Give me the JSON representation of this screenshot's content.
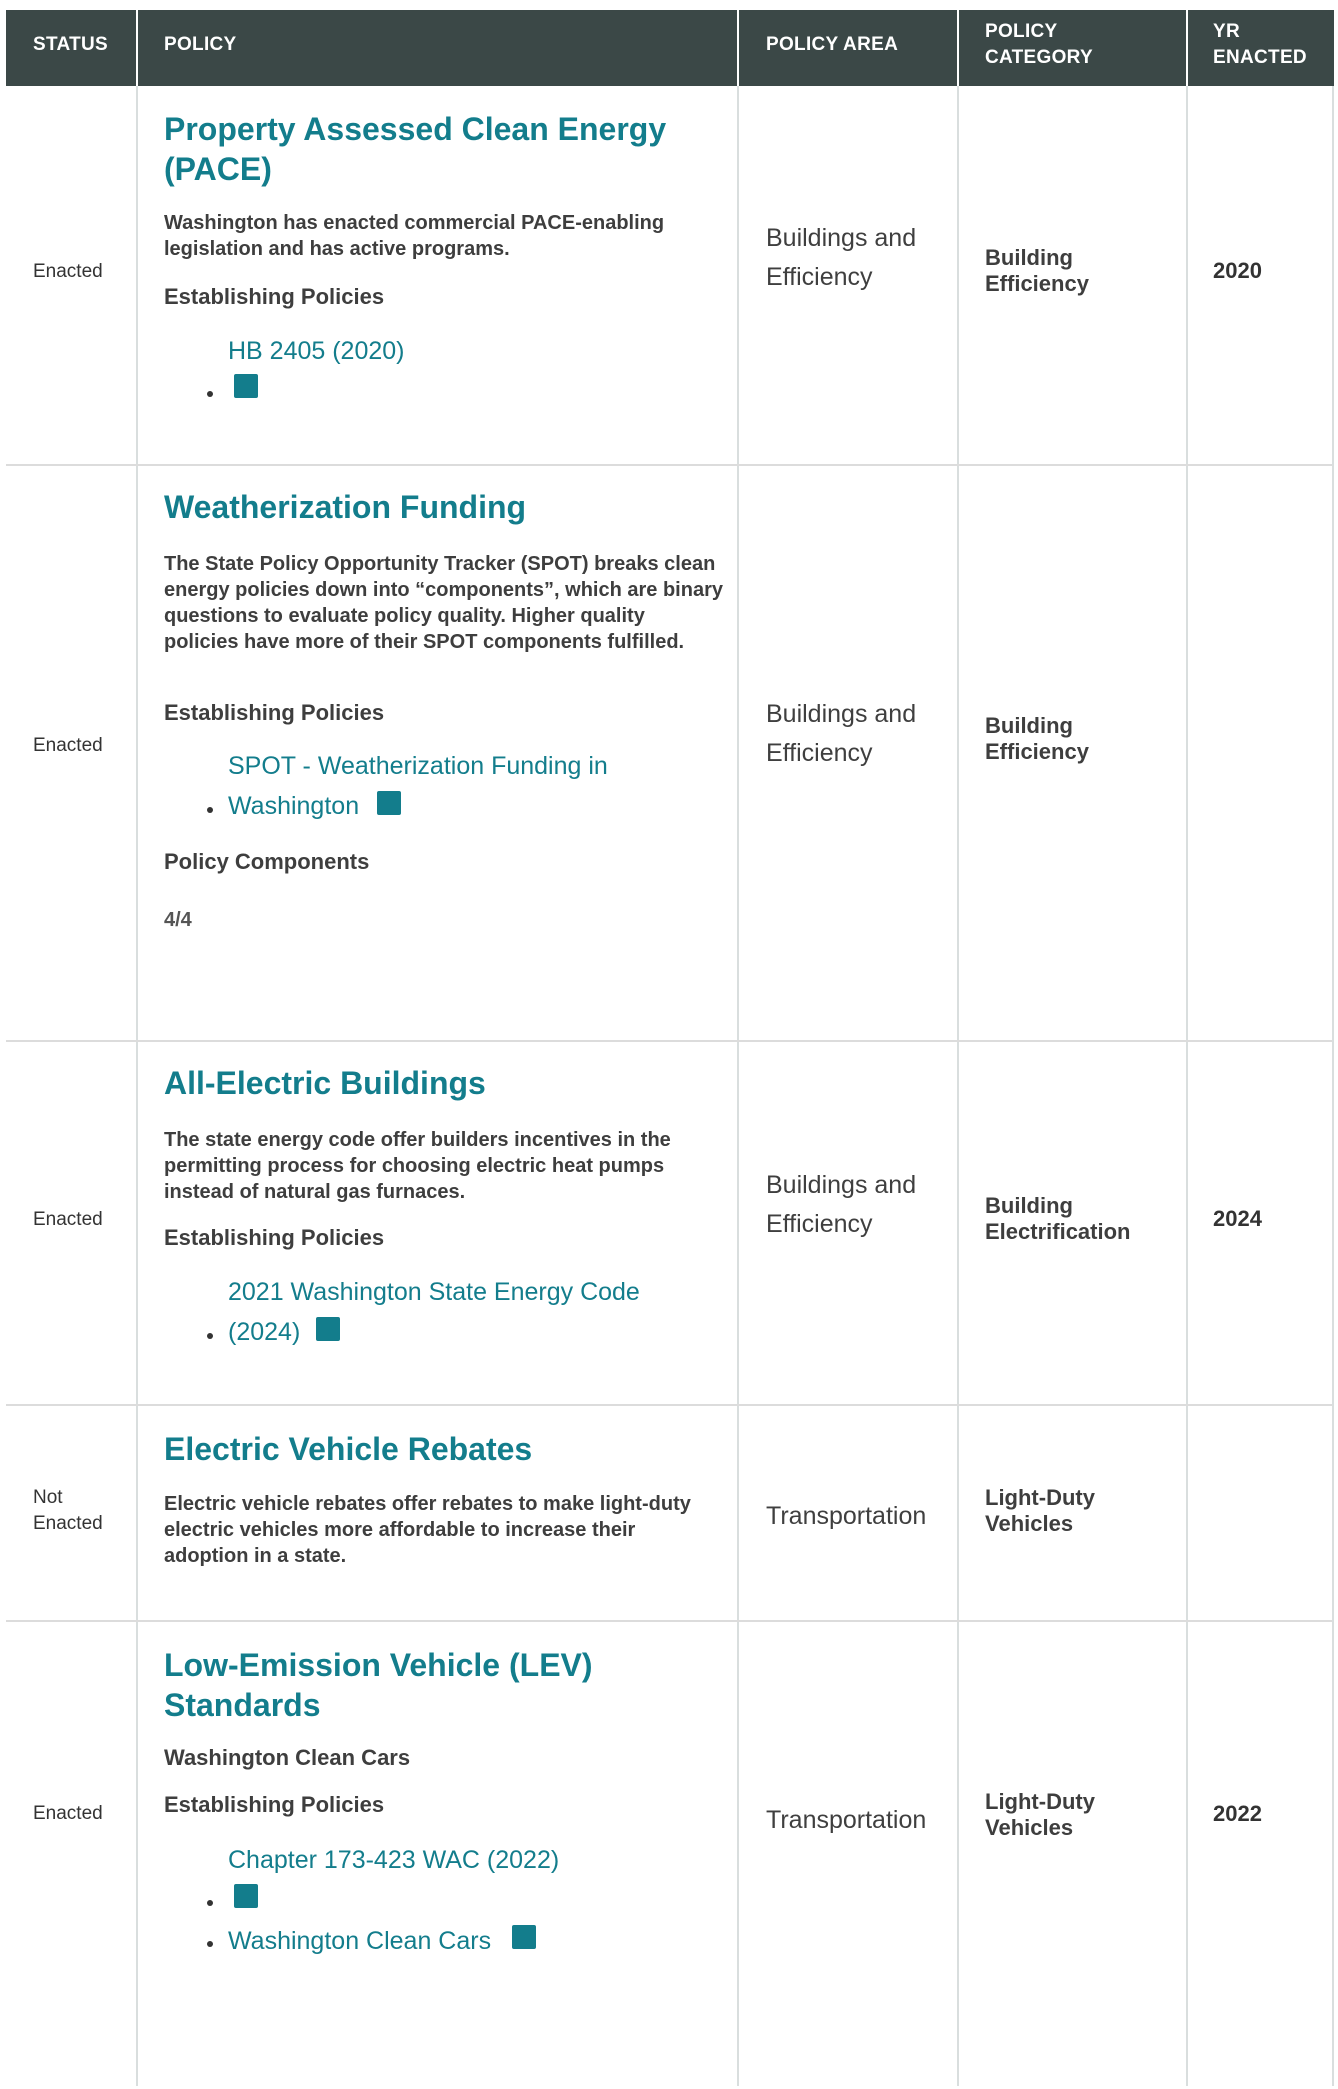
{
  "table": {
    "headers": {
      "status": "STATUS",
      "policy": "POLICY",
      "policy_area": "POLICY AREA",
      "policy_category": "POLICY CATEGORY",
      "yr_enacted": "YR ENACTED"
    },
    "rows": [
      {
        "status": "Enacted",
        "title": "Property Assessed Clean Energy (PACE)",
        "description": "Washington has enacted commercial PACE-enabling legislation and has active programs.",
        "establishing_label": "Establishing Policies",
        "links": [
          {
            "text": "HB 2405 (2020)"
          }
        ],
        "area": "Buildings and Efficiency",
        "category": "Building Efficiency",
        "year": "2020"
      },
      {
        "status": "Enacted",
        "title": "Weatherization Funding",
        "description": "The State Policy Opportunity Tracker (SPOT) breaks clean energy policies down into “components”, which are binary questions to evaluate policy quality. Higher quality policies have more of their SPOT components fulfilled.",
        "establishing_label": "Establishing Policies",
        "links": [
          {
            "text": "SPOT - Weatherization Funding in Washington"
          }
        ],
        "components_label": "Policy Components",
        "components_value": "4/4",
        "area": "Buildings and Efficiency",
        "category": "Building Efficiency",
        "year": ""
      },
      {
        "status": "Enacted",
        "title": "All-Electric Buildings",
        "description": "The state energy code offer builders incentives in the permitting process for choosing electric heat pumps instead of natural gas furnaces.",
        "establishing_label": "Establishing Policies",
        "links": [
          {
            "text": "2021 Washington State Energy Code (2024)"
          }
        ],
        "area": "Buildings and Efficiency",
        "category": "Building Electrification",
        "year": "2024"
      },
      {
        "status": "Not Enacted",
        "title": "Electric Vehicle Rebates",
        "description": "Electric vehicle rebates offer rebates to make light-duty electric vehicles more affordable to increase their adoption in a state.",
        "area": "Transportation",
        "category": "Light-Duty Vehicles",
        "year": ""
      },
      {
        "status": "Enacted",
        "title": "Low-Emission Vehicle (LEV) Standards",
        "description": "Washington Clean Cars",
        "establishing_label": "Establishing Policies",
        "links": [
          {
            "text": "Chapter 173-423 WAC (2022)"
          },
          {
            "text": "Washington Clean Cars"
          }
        ],
        "area": "Transportation",
        "category": "Light-Duty Vehicles",
        "year": "2022"
      }
    ]
  },
  "icons": {
    "external_link": "external-link-icon"
  },
  "colors": {
    "header_bg": "#3b4847",
    "link": "#137d8c",
    "text": "#333333"
  }
}
